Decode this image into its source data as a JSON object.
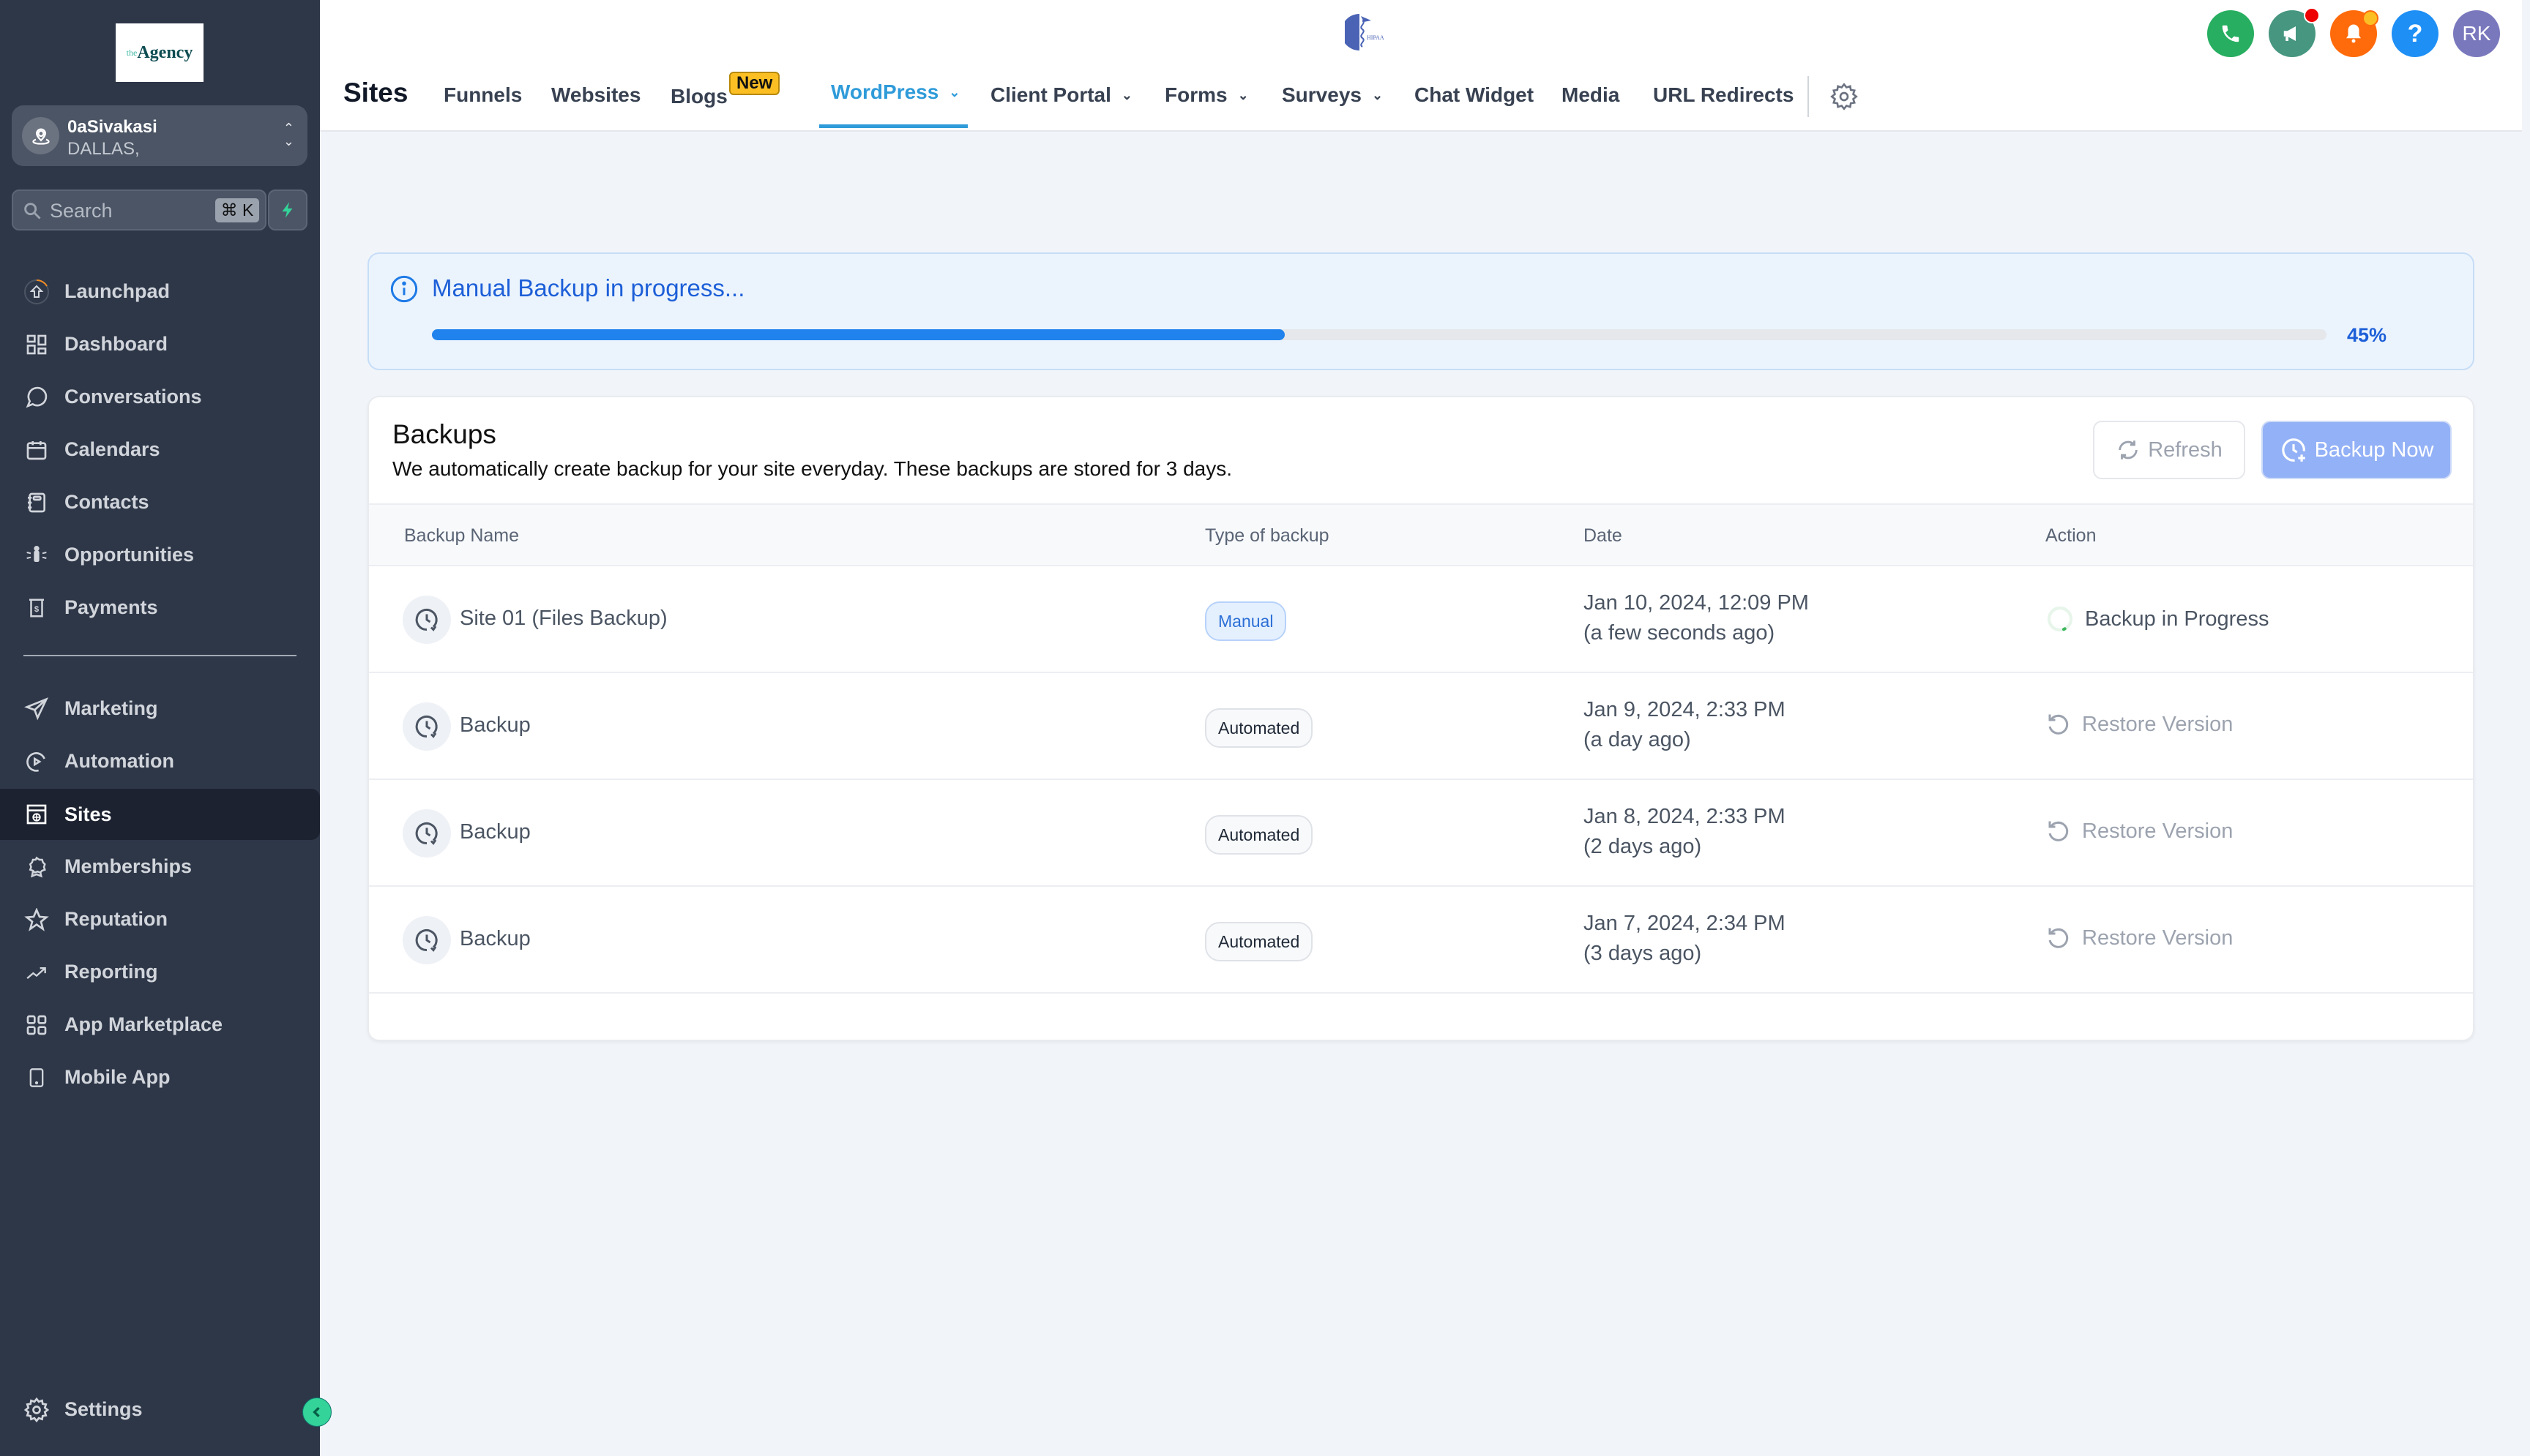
{
  "sidebar": {
    "logo": {
      "prefix": "the",
      "name": "Agency"
    },
    "location": {
      "name": "0aSivakasi",
      "city": "DALLAS,"
    },
    "search": {
      "placeholder": "Search",
      "shortcut": "⌘ K"
    },
    "items_top": [
      {
        "label": "Launchpad",
        "icon": "launchpad-icon"
      },
      {
        "label": "Dashboard",
        "icon": "dashboard-icon"
      },
      {
        "label": "Conversations",
        "icon": "chat-bubble-icon"
      },
      {
        "label": "Calendars",
        "icon": "calendar-icon"
      },
      {
        "label": "Contacts",
        "icon": "contacts-book-icon"
      },
      {
        "label": "Opportunities",
        "icon": "opportunities-icon"
      },
      {
        "label": "Payments",
        "icon": "payments-icon"
      }
    ],
    "items_bottom": [
      {
        "label": "Marketing",
        "icon": "send-icon"
      },
      {
        "label": "Automation",
        "icon": "automation-icon"
      },
      {
        "label": "Sites",
        "icon": "sites-globe-icon",
        "active": true
      },
      {
        "label": "Memberships",
        "icon": "badge-icon"
      },
      {
        "label": "Reputation",
        "icon": "star-icon"
      },
      {
        "label": "Reporting",
        "icon": "trend-icon"
      },
      {
        "label": "App Marketplace",
        "icon": "grid-icon"
      },
      {
        "label": "Mobile App",
        "icon": "mobile-icon"
      }
    ],
    "settings_label": "Settings"
  },
  "header": {
    "title": "Sites",
    "tabs": [
      {
        "label": "Funnels"
      },
      {
        "label": "Websites"
      },
      {
        "label": "Blogs",
        "badge": "New"
      },
      {
        "label": "WordPress",
        "dropdown": true,
        "active": true
      },
      {
        "label": "Client Portal",
        "dropdown": true
      },
      {
        "label": "Forms",
        "dropdown": true
      },
      {
        "label": "Surveys",
        "dropdown": true
      },
      {
        "label": "Chat Widget"
      },
      {
        "label": "Media"
      },
      {
        "label": "URL Redirects"
      }
    ],
    "avatar_initials": "RK",
    "colors": {
      "phone": "#27ae60",
      "announce": "#469680",
      "bell": "#ff6a0a",
      "help": "#1e8ff5",
      "avatar": "#7a78bd"
    }
  },
  "banner": {
    "message": "Manual Backup in progress...",
    "progress_percent": 45,
    "progress_label": "45%"
  },
  "backups": {
    "title": "Backups",
    "subtitle": "We automatically create backup for your site everyday. These backups are stored for 3 days.",
    "refresh_label": "Refresh",
    "backup_now_label": "Backup Now",
    "columns": [
      "Backup Name",
      "Type of backup",
      "Date",
      "Action"
    ],
    "rows": [
      {
        "name": "Site 01 (Files Backup)",
        "type": "Manual",
        "date": "Jan 10, 2024, 12:09 PM",
        "relative": "(a few seconds ago)",
        "action": "Backup in Progress"
      },
      {
        "name": "Backup",
        "type": "Automated",
        "date": "Jan 9, 2024, 2:33 PM",
        "relative": "(a day ago)",
        "action": "Restore Version"
      },
      {
        "name": "Backup",
        "type": "Automated",
        "date": "Jan 8, 2024, 2:33 PM",
        "relative": "(2 days ago)",
        "action": "Restore Version"
      },
      {
        "name": "Backup",
        "type": "Automated",
        "date": "Jan 7, 2024, 2:34 PM",
        "relative": "(3 days ago)",
        "action": "Restore Version"
      }
    ]
  }
}
